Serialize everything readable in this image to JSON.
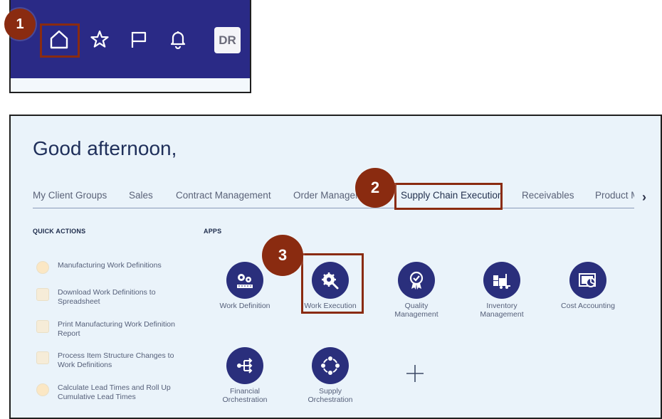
{
  "header": {
    "avatar_initials": "DR",
    "icons": [
      "home-icon",
      "star-icon",
      "flag-icon",
      "bell-icon"
    ],
    "bar_color": "#2a2a86"
  },
  "annotations": {
    "step1": "1",
    "step2": "2",
    "step3": "3",
    "color": "#8a2b10"
  },
  "home": {
    "greeting": "Good afternoon,",
    "tabs": [
      "My Client Groups",
      "Sales",
      "Contract Management",
      "Order Management",
      "Supply Chain Execution",
      "Receivables",
      "Product Management"
    ],
    "active_tab": "Supply Chain Execution",
    "quick_actions_heading": "QUICK ACTIONS",
    "apps_heading": "APPS",
    "quick_actions": [
      {
        "line1": "Manufacturing Work Definitions",
        "line2": ""
      },
      {
        "line1": "Download Work Definitions to",
        "line2": "Spreadsheet"
      },
      {
        "line1": "Print Manufacturing Work Definition",
        "line2": "Report"
      },
      {
        "line1": "Process Item Structure Changes to",
        "line2": "Work Definitions"
      },
      {
        "line1": "Calculate Lead Times and Roll Up",
        "line2": "Cumulative Lead Times"
      }
    ],
    "apps": [
      {
        "line1": "Work Definition",
        "line2": "",
        "icon": "gears-icon"
      },
      {
        "line1": "Work Execution",
        "line2": "",
        "icon": "gear-wrench-icon"
      },
      {
        "line1": "Quality",
        "line2": "Management",
        "icon": "award-icon"
      },
      {
        "line1": "Inventory",
        "line2": "Management",
        "icon": "forklift-icon"
      },
      {
        "line1": "Cost Accounting",
        "line2": "",
        "icon": "report-chart-icon"
      },
      {
        "line1": "Financial",
        "line2": "Orchestration",
        "icon": "flow-icon"
      },
      {
        "line1": "Supply",
        "line2": "Orchestration",
        "icon": "cycle-icon"
      }
    ]
  }
}
